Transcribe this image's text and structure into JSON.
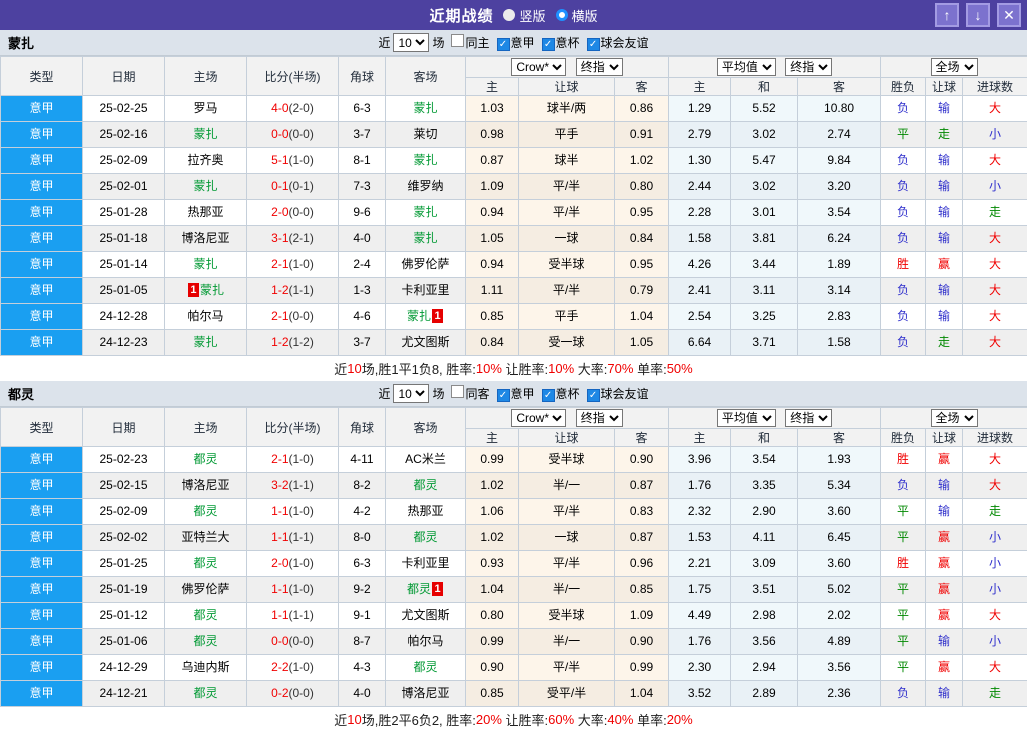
{
  "titlebar": {
    "title": "近期战绩",
    "radio1": "竖版",
    "radio2": "横版",
    "up_glyph": "↑",
    "down_glyph": "↓",
    "close_glyph": "✕"
  },
  "colors": {
    "accent_purple": "#4D41A0",
    "league_blue": "#1A9FF1",
    "team_green": "#009933",
    "score_red": "#F00000"
  },
  "columns": [
    "类型",
    "日期",
    "主场",
    "比分(半场)",
    "角球",
    "客场"
  ],
  "sub_columns": [
    "主",
    "让球",
    "客",
    "主",
    "和",
    "客",
    "胜负",
    "让球",
    "进球数"
  ],
  "selects": {
    "crow": "Crow*",
    "final": "终指",
    "avg": "平均值",
    "final2": "终指",
    "fullmatch": "全场"
  },
  "filter_labels": {
    "near": "近",
    "games": "场"
  },
  "sections": [
    {
      "team": "蒙扎",
      "filter": {
        "count": "10",
        "checkboxes": [
          {
            "label": "同主",
            "checked": false
          },
          {
            "label": "意甲",
            "checked": true
          },
          {
            "label": "意杯",
            "checked": true
          },
          {
            "label": "球会友谊",
            "checked": true
          }
        ]
      },
      "rows": [
        {
          "league": "意甲",
          "date": "25-02-25",
          "home": {
            "name": "罗马",
            "green": false
          },
          "score_ft": "4-0",
          "score_ht": "(2-0)",
          "corner": "6-3",
          "away": {
            "name": "蒙扎",
            "green": true
          },
          "odds": [
            "1.03",
            "球半/两",
            "0.86"
          ],
          "avg": [
            "1.29",
            "5.52",
            "10.80"
          ],
          "result": [
            "负",
            "输",
            "大"
          ]
        },
        {
          "league": "意甲",
          "date": "25-02-16",
          "home": {
            "name": "蒙扎",
            "green": true
          },
          "score_ft": "0-0",
          "score_ht": "(0-0)",
          "corner": "3-7",
          "away": {
            "name": "莱切",
            "green": false
          },
          "odds": [
            "0.98",
            "平手",
            "0.91"
          ],
          "avg": [
            "2.79",
            "3.02",
            "2.74"
          ],
          "result": [
            "平",
            "走",
            "小"
          ]
        },
        {
          "league": "意甲",
          "date": "25-02-09",
          "home": {
            "name": "拉齐奥",
            "green": false
          },
          "score_ft": "5-1",
          "score_ht": "(1-0)",
          "corner": "8-1",
          "away": {
            "name": "蒙扎",
            "green": true
          },
          "odds": [
            "0.87",
            "球半",
            "1.02"
          ],
          "avg": [
            "1.30",
            "5.47",
            "9.84"
          ],
          "result": [
            "负",
            "输",
            "大"
          ]
        },
        {
          "league": "意甲",
          "date": "25-02-01",
          "home": {
            "name": "蒙扎",
            "green": true
          },
          "score_ft": "0-1",
          "score_ht": "(0-1)",
          "corner": "7-3",
          "away": {
            "name": "维罗纳",
            "green": false
          },
          "odds": [
            "1.09",
            "平/半",
            "0.80"
          ],
          "avg": [
            "2.44",
            "3.02",
            "3.20"
          ],
          "result": [
            "负",
            "输",
            "小"
          ]
        },
        {
          "league": "意甲",
          "date": "25-01-28",
          "home": {
            "name": "热那亚",
            "green": false
          },
          "score_ft": "2-0",
          "score_ht": "(0-0)",
          "corner": "9-6",
          "away": {
            "name": "蒙扎",
            "green": true
          },
          "odds": [
            "0.94",
            "平/半",
            "0.95"
          ],
          "avg": [
            "2.28",
            "3.01",
            "3.54"
          ],
          "result": [
            "负",
            "输",
            "走"
          ]
        },
        {
          "league": "意甲",
          "date": "25-01-18",
          "home": {
            "name": "博洛尼亚",
            "green": false
          },
          "score_ft": "3-1",
          "score_ht": "(2-1)",
          "corner": "4-0",
          "away": {
            "name": "蒙扎",
            "green": true
          },
          "odds": [
            "1.05",
            "一球",
            "0.84"
          ],
          "avg": [
            "1.58",
            "3.81",
            "6.24"
          ],
          "result": [
            "负",
            "输",
            "大"
          ]
        },
        {
          "league": "意甲",
          "date": "25-01-14",
          "home": {
            "name": "蒙扎",
            "green": true
          },
          "score_ft": "2-1",
          "score_ht": "(1-0)",
          "corner": "2-4",
          "away": {
            "name": "佛罗伦萨",
            "green": false
          },
          "odds": [
            "0.94",
            "受半球",
            "0.95"
          ],
          "avg": [
            "4.26",
            "3.44",
            "1.89"
          ],
          "result": [
            "胜",
            "赢",
            "大"
          ]
        },
        {
          "league": "意甲",
          "date": "25-01-05",
          "home": {
            "name": "蒙扎",
            "green": true,
            "badge_pre": "1"
          },
          "score_ft": "1-2",
          "score_ht": "(1-1)",
          "corner": "1-3",
          "away": {
            "name": "卡利亚里",
            "green": false
          },
          "odds": [
            "1.11",
            "平/半",
            "0.79"
          ],
          "avg": [
            "2.41",
            "3.11",
            "3.14"
          ],
          "result": [
            "负",
            "输",
            "大"
          ]
        },
        {
          "league": "意甲",
          "date": "24-12-28",
          "home": {
            "name": "帕尔马",
            "green": false
          },
          "score_ft": "2-1",
          "score_ht": "(0-0)",
          "corner": "4-6",
          "away": {
            "name": "蒙扎",
            "green": true,
            "badge_post": "1"
          },
          "odds": [
            "0.85",
            "平手",
            "1.04"
          ],
          "avg": [
            "2.54",
            "3.25",
            "2.83"
          ],
          "result": [
            "负",
            "输",
            "大"
          ]
        },
        {
          "league": "意甲",
          "date": "24-12-23",
          "home": {
            "name": "蒙扎",
            "green": true
          },
          "score_ft": "1-2",
          "score_ht": "(1-2)",
          "corner": "3-7",
          "away": {
            "name": "尤文图斯",
            "green": false
          },
          "odds": [
            "0.84",
            "受一球",
            "1.05"
          ],
          "avg": [
            "6.64",
            "3.71",
            "1.58"
          ],
          "result": [
            "负",
            "走",
            "大"
          ]
        }
      ],
      "summary": [
        {
          "t": "近",
          "c": "k"
        },
        {
          "t": "10",
          "c": "r"
        },
        {
          "t": "场,胜1平1负8, 胜率:",
          "c": "k"
        },
        {
          "t": "10%",
          "c": "r"
        },
        {
          "t": " 让胜率:",
          "c": "k"
        },
        {
          "t": "10%",
          "c": "r"
        },
        {
          "t": " 大率:",
          "c": "k"
        },
        {
          "t": "70%",
          "c": "r"
        },
        {
          "t": " 单率:",
          "c": "k"
        },
        {
          "t": "50%",
          "c": "r"
        }
      ]
    },
    {
      "team": "都灵",
      "filter": {
        "count": "10",
        "checkboxes": [
          {
            "label": "同客",
            "checked": false
          },
          {
            "label": "意甲",
            "checked": true
          },
          {
            "label": "意杯",
            "checked": true
          },
          {
            "label": "球会友谊",
            "checked": true
          }
        ]
      },
      "rows": [
        {
          "league": "意甲",
          "date": "25-02-23",
          "home": {
            "name": "都灵",
            "green": true
          },
          "score_ft": "2-1",
          "score_ht": "(1-0)",
          "corner": "4-11",
          "away": {
            "name": "AC米兰",
            "green": false
          },
          "odds": [
            "0.99",
            "受半球",
            "0.90"
          ],
          "avg": [
            "3.96",
            "3.54",
            "1.93"
          ],
          "result": [
            "胜",
            "赢",
            "大"
          ]
        },
        {
          "league": "意甲",
          "date": "25-02-15",
          "home": {
            "name": "博洛尼亚",
            "green": false
          },
          "score_ft": "3-2",
          "score_ht": "(1-1)",
          "corner": "8-2",
          "away": {
            "name": "都灵",
            "green": true
          },
          "odds": [
            "1.02",
            "半/一",
            "0.87"
          ],
          "avg": [
            "1.76",
            "3.35",
            "5.34"
          ],
          "result": [
            "负",
            "输",
            "大"
          ]
        },
        {
          "league": "意甲",
          "date": "25-02-09",
          "home": {
            "name": "都灵",
            "green": true
          },
          "score_ft": "1-1",
          "score_ht": "(1-0)",
          "corner": "4-2",
          "away": {
            "name": "热那亚",
            "green": false
          },
          "odds": [
            "1.06",
            "平/半",
            "0.83"
          ],
          "avg": [
            "2.32",
            "2.90",
            "3.60"
          ],
          "result": [
            "平",
            "输",
            "走"
          ]
        },
        {
          "league": "意甲",
          "date": "25-02-02",
          "home": {
            "name": "亚特兰大",
            "green": false
          },
          "score_ft": "1-1",
          "score_ht": "(1-1)",
          "corner": "8-0",
          "away": {
            "name": "都灵",
            "green": true
          },
          "odds": [
            "1.02",
            "一球",
            "0.87"
          ],
          "avg": [
            "1.53",
            "4.11",
            "6.45"
          ],
          "result": [
            "平",
            "赢",
            "小"
          ]
        },
        {
          "league": "意甲",
          "date": "25-01-25",
          "home": {
            "name": "都灵",
            "green": true
          },
          "score_ft": "2-0",
          "score_ht": "(1-0)",
          "corner": "6-3",
          "away": {
            "name": "卡利亚里",
            "green": false
          },
          "odds": [
            "0.93",
            "平/半",
            "0.96"
          ],
          "avg": [
            "2.21",
            "3.09",
            "3.60"
          ],
          "result": [
            "胜",
            "赢",
            "小"
          ]
        },
        {
          "league": "意甲",
          "date": "25-01-19",
          "home": {
            "name": "佛罗伦萨",
            "green": false
          },
          "score_ft": "1-1",
          "score_ht": "(1-0)",
          "corner": "9-2",
          "away": {
            "name": "都灵",
            "green": true,
            "badge_post": "1"
          },
          "odds": [
            "1.04",
            "半/一",
            "0.85"
          ],
          "avg": [
            "1.75",
            "3.51",
            "5.02"
          ],
          "result": [
            "平",
            "赢",
            "小"
          ]
        },
        {
          "league": "意甲",
          "date": "25-01-12",
          "home": {
            "name": "都灵",
            "green": true
          },
          "score_ft": "1-1",
          "score_ht": "(1-1)",
          "corner": "9-1",
          "away": {
            "name": "尤文图斯",
            "green": false
          },
          "odds": [
            "0.80",
            "受半球",
            "1.09"
          ],
          "avg": [
            "4.49",
            "2.98",
            "2.02"
          ],
          "result": [
            "平",
            "赢",
            "大"
          ]
        },
        {
          "league": "意甲",
          "date": "25-01-06",
          "home": {
            "name": "都灵",
            "green": true
          },
          "score_ft": "0-0",
          "score_ht": "(0-0)",
          "corner": "8-7",
          "away": {
            "name": "帕尔马",
            "green": false
          },
          "odds": [
            "0.99",
            "半/一",
            "0.90"
          ],
          "avg": [
            "1.76",
            "3.56",
            "4.89"
          ],
          "result": [
            "平",
            "输",
            "小"
          ]
        },
        {
          "league": "意甲",
          "date": "24-12-29",
          "home": {
            "name": "乌迪内斯",
            "green": false
          },
          "score_ft": "2-2",
          "score_ht": "(1-0)",
          "corner": "4-3",
          "away": {
            "name": "都灵",
            "green": true
          },
          "odds": [
            "0.90",
            "平/半",
            "0.99"
          ],
          "avg": [
            "2.30",
            "2.94",
            "3.56"
          ],
          "result": [
            "平",
            "赢",
            "大"
          ]
        },
        {
          "league": "意甲",
          "date": "24-12-21",
          "home": {
            "name": "都灵",
            "green": true
          },
          "score_ft": "0-2",
          "score_ht": "(0-0)",
          "corner": "4-0",
          "away": {
            "name": "博洛尼亚",
            "green": false
          },
          "odds": [
            "0.85",
            "受平/半",
            "1.04"
          ],
          "avg": [
            "3.52",
            "2.89",
            "2.36"
          ],
          "result": [
            "负",
            "输",
            "走"
          ]
        }
      ],
      "summary": [
        {
          "t": "近",
          "c": "k"
        },
        {
          "t": "10",
          "c": "r"
        },
        {
          "t": "场,胜2平6负2, 胜率:",
          "c": "k"
        },
        {
          "t": "20%",
          "c": "r"
        },
        {
          "t": " 让胜率:",
          "c": "k"
        },
        {
          "t": "60%",
          "c": "r"
        },
        {
          "t": " 大率:",
          "c": "k"
        },
        {
          "t": "40%",
          "c": "r"
        },
        {
          "t": " 单率:",
          "c": "k"
        },
        {
          "t": "20%",
          "c": "r"
        }
      ]
    }
  ]
}
